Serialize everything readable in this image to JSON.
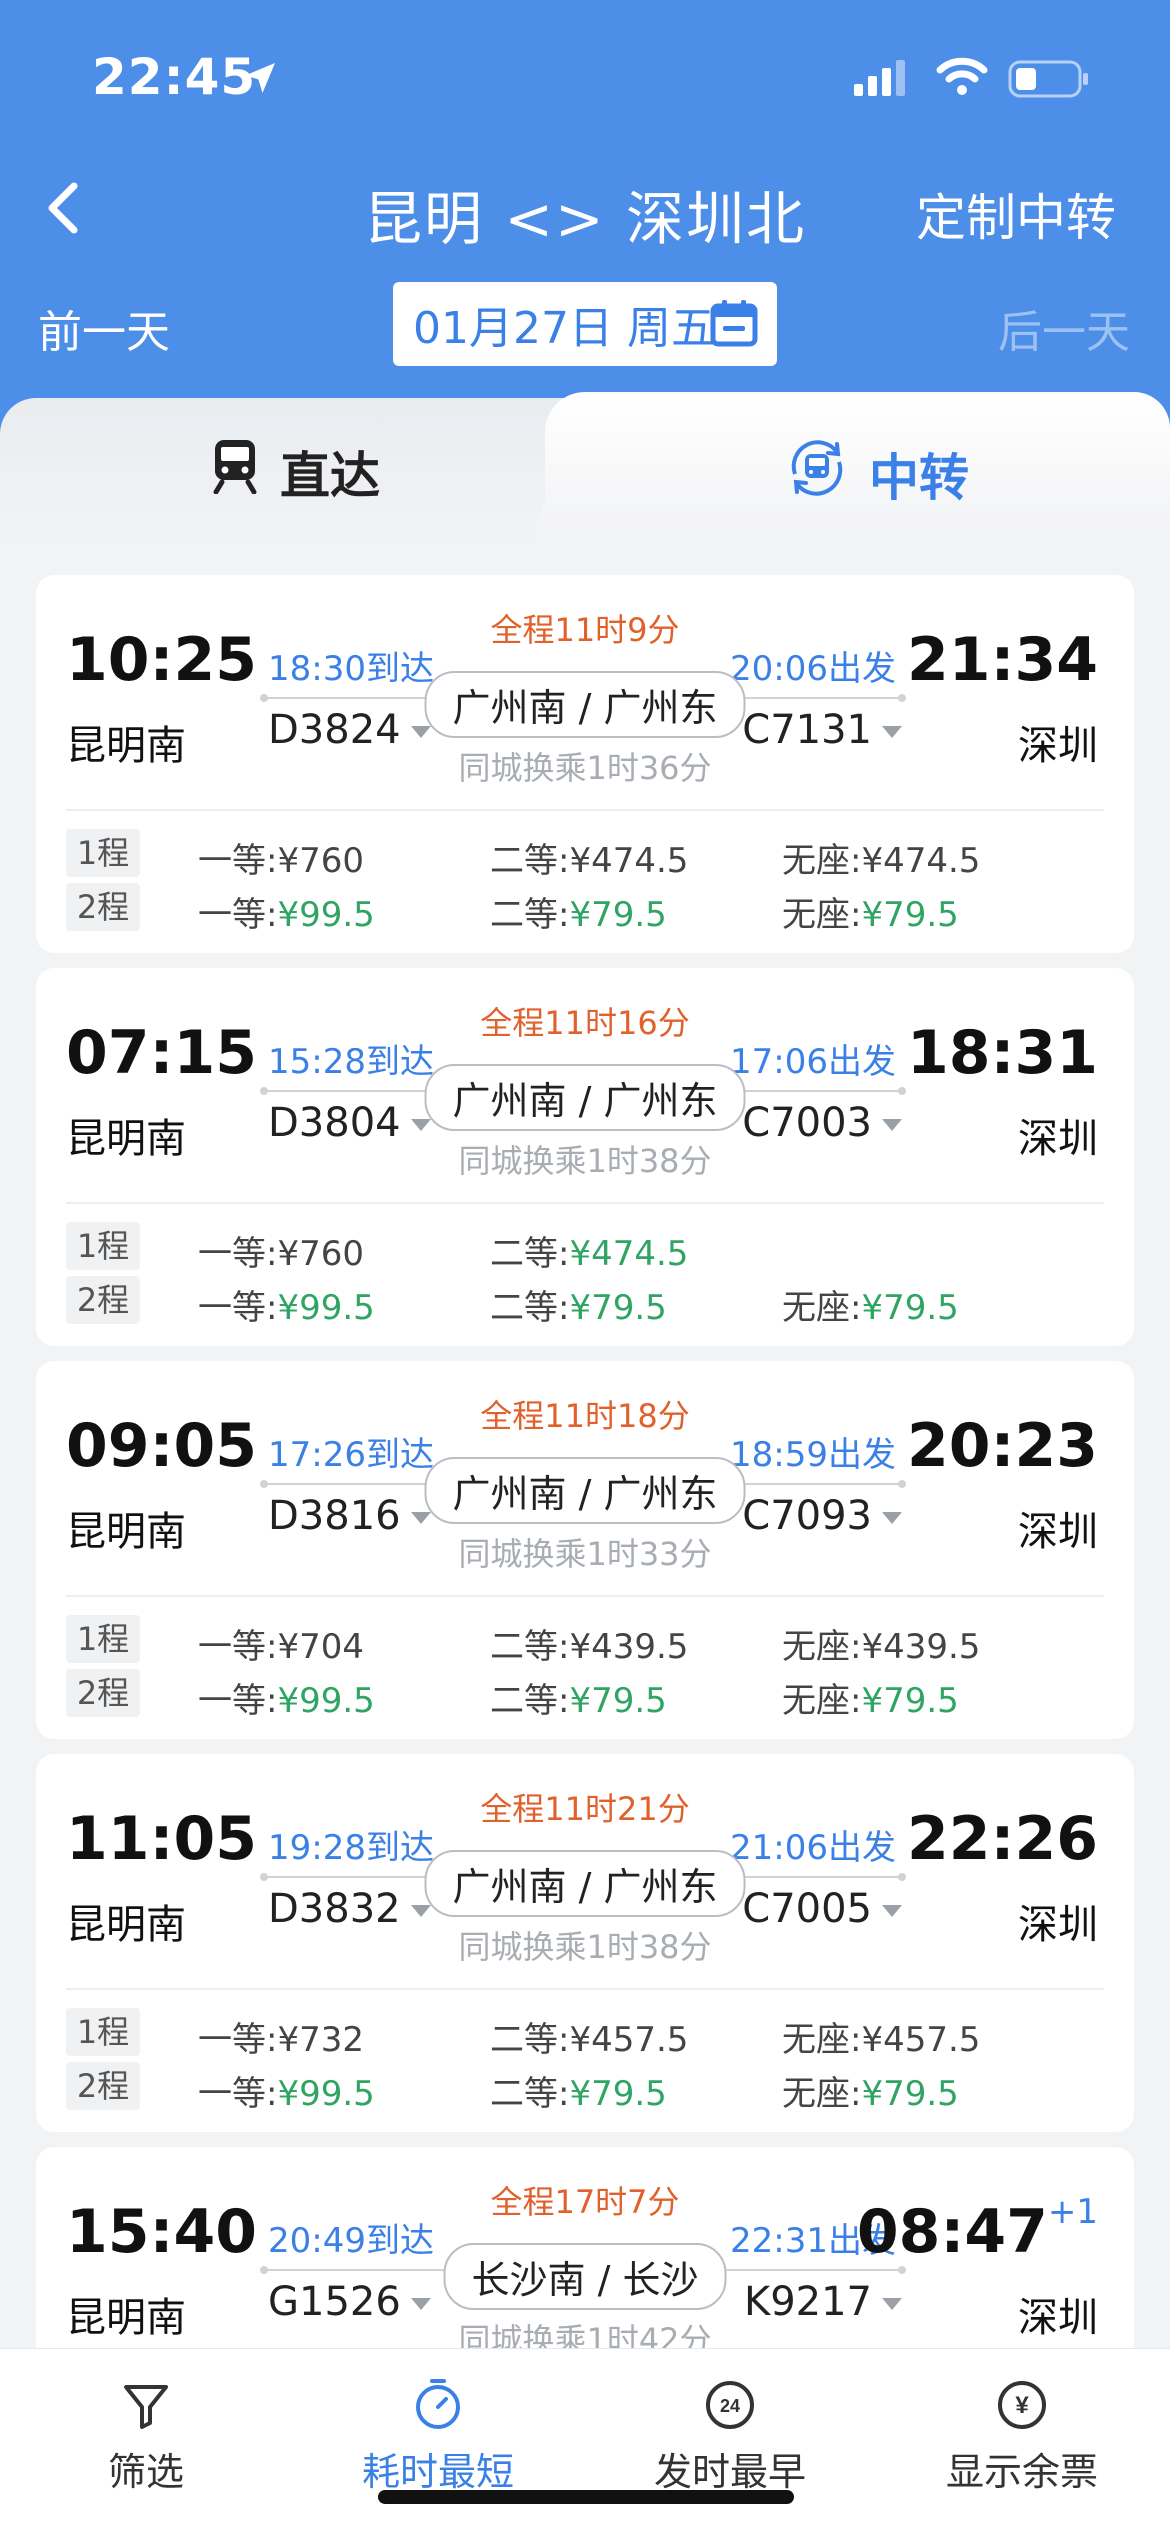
{
  "status_bar": {
    "time": "22:45"
  },
  "nav": {
    "title": "昆明 <> 深圳北",
    "right_action": "定制中转"
  },
  "date_bar": {
    "prev": "前一天",
    "date": "01月27日 周五",
    "next": "后一天"
  },
  "tabs": {
    "direct": "直达",
    "transfer": "中转",
    "active": "transfer"
  },
  "colors": {
    "header_blue": "#4c8ee8",
    "accent_blue": "#3a80e6",
    "duration_orange": "#e0612b",
    "price_green": "#2fa463"
  },
  "results": [
    {
      "dep_time": "10:25",
      "dep_station": "昆明南",
      "arr_time": "21:34",
      "arr_station": "深圳",
      "day_offset": "",
      "total_duration": "全程11时9分",
      "leg1_arrive": "18:30到达",
      "leg2_depart": "20:06出发",
      "transfer_stations": "广州南 / 广州东",
      "leg1_train": "D3824",
      "leg2_train": "C7131",
      "wait": "同城换乘1时36分",
      "legs": [
        {
          "label": "1程",
          "prices": [
            {
              "cls": "一等:",
              "val": "¥760",
              "avail": false
            },
            {
              "cls": "二等:",
              "val": "¥474.5",
              "avail": false
            },
            {
              "cls": "无座:",
              "val": "¥474.5",
              "avail": false
            }
          ]
        },
        {
          "label": "2程",
          "prices": [
            {
              "cls": "一等:",
              "val": "¥99.5",
              "avail": true
            },
            {
              "cls": "二等:",
              "val": "¥79.5",
              "avail": true
            },
            {
              "cls": "无座:",
              "val": "¥79.5",
              "avail": true
            }
          ]
        }
      ]
    },
    {
      "dep_time": "07:15",
      "dep_station": "昆明南",
      "arr_time": "18:31",
      "arr_station": "深圳",
      "day_offset": "",
      "total_duration": "全程11时16分",
      "leg1_arrive": "15:28到达",
      "leg2_depart": "17:06出发",
      "transfer_stations": "广州南 / 广州东",
      "leg1_train": "D3804",
      "leg2_train": "C7003",
      "wait": "同城换乘1时38分",
      "legs": [
        {
          "label": "1程",
          "prices": [
            {
              "cls": "一等:",
              "val": "¥760",
              "avail": false
            },
            {
              "cls": "二等:",
              "val": "¥474.5",
              "avail": true
            },
            {
              "cls": "",
              "val": "",
              "avail": false
            }
          ]
        },
        {
          "label": "2程",
          "prices": [
            {
              "cls": "一等:",
              "val": "¥99.5",
              "avail": true
            },
            {
              "cls": "二等:",
              "val": "¥79.5",
              "avail": true
            },
            {
              "cls": "无座:",
              "val": "¥79.5",
              "avail": true
            }
          ]
        }
      ]
    },
    {
      "dep_time": "09:05",
      "dep_station": "昆明南",
      "arr_time": "20:23",
      "arr_station": "深圳",
      "day_offset": "",
      "total_duration": "全程11时18分",
      "leg1_arrive": "17:26到达",
      "leg2_depart": "18:59出发",
      "transfer_stations": "广州南 / 广州东",
      "leg1_train": "D3816",
      "leg2_train": "C7093",
      "wait": "同城换乘1时33分",
      "legs": [
        {
          "label": "1程",
          "prices": [
            {
              "cls": "一等:",
              "val": "¥704",
              "avail": false
            },
            {
              "cls": "二等:",
              "val": "¥439.5",
              "avail": false
            },
            {
              "cls": "无座:",
              "val": "¥439.5",
              "avail": false
            }
          ]
        },
        {
          "label": "2程",
          "prices": [
            {
              "cls": "一等:",
              "val": "¥99.5",
              "avail": true
            },
            {
              "cls": "二等:",
              "val": "¥79.5",
              "avail": true
            },
            {
              "cls": "无座:",
              "val": "¥79.5",
              "avail": true
            }
          ]
        }
      ]
    },
    {
      "dep_time": "11:05",
      "dep_station": "昆明南",
      "arr_time": "22:26",
      "arr_station": "深圳",
      "day_offset": "",
      "total_duration": "全程11时21分",
      "leg1_arrive": "19:28到达",
      "leg2_depart": "21:06出发",
      "transfer_stations": "广州南 / 广州东",
      "leg1_train": "D3832",
      "leg2_train": "C7005",
      "wait": "同城换乘1时38分",
      "legs": [
        {
          "label": "1程",
          "prices": [
            {
              "cls": "一等:",
              "val": "¥732",
              "avail": false
            },
            {
              "cls": "二等:",
              "val": "¥457.5",
              "avail": false
            },
            {
              "cls": "无座:",
              "val": "¥457.5",
              "avail": false
            }
          ]
        },
        {
          "label": "2程",
          "prices": [
            {
              "cls": "一等:",
              "val": "¥99.5",
              "avail": true
            },
            {
              "cls": "二等:",
              "val": "¥79.5",
              "avail": true
            },
            {
              "cls": "无座:",
              "val": "¥79.5",
              "avail": true
            }
          ]
        }
      ]
    },
    {
      "dep_time": "15:40",
      "dep_station": "昆明南",
      "arr_time": "08:47",
      "arr_station": "深圳",
      "day_offset": "+1",
      "total_duration": "全程17时7分",
      "leg1_arrive": "20:49到达",
      "leg2_depart": "22:31出发",
      "transfer_stations": "长沙南 / 长沙",
      "leg1_train": "G1526",
      "leg2_train": "K9217",
      "wait": "同城换乘1时42分",
      "legs": []
    }
  ],
  "bottom_bar": [
    {
      "label": "筛选",
      "icon": "filter-icon",
      "active": false
    },
    {
      "label": "耗时最短",
      "icon": "stopwatch-icon",
      "active": true
    },
    {
      "label": "发时最早",
      "icon": "24h-clock-icon",
      "active": false
    },
    {
      "label": "显示余票",
      "icon": "yen-icon",
      "active": false
    }
  ]
}
